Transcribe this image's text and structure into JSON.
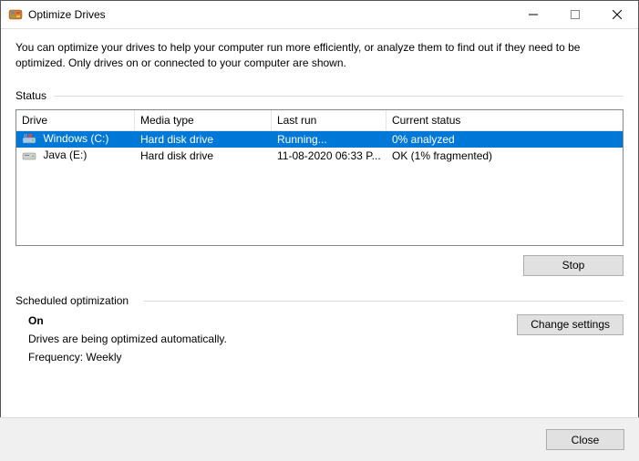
{
  "window": {
    "title": "Optimize Drives"
  },
  "description": "You can optimize your drives to help your computer run more efficiently, or analyze them to find out if they need to be optimized. Only drives on or connected to your computer are shown.",
  "sections": {
    "status_label": "Status",
    "scheduled_label": "Scheduled optimization"
  },
  "columns": {
    "drive": "Drive",
    "media": "Media type",
    "last": "Last run",
    "status": "Current status"
  },
  "drives": [
    {
      "name": "Windows (C:)",
      "media": "Hard disk drive",
      "last": "Running...",
      "status": "0% analyzed",
      "selected": true,
      "icon": "os-drive"
    },
    {
      "name": "Java (E:)",
      "media": "Hard disk drive",
      "last": "11-08-2020 06:33 P...",
      "status": "OK (1% fragmented)",
      "selected": false,
      "icon": "drive"
    }
  ],
  "buttons": {
    "stop": "Stop",
    "change": "Change settings",
    "close": "Close"
  },
  "schedule": {
    "state": "On",
    "line1": "Drives are being optimized automatically.",
    "line2": "Frequency: Weekly"
  }
}
